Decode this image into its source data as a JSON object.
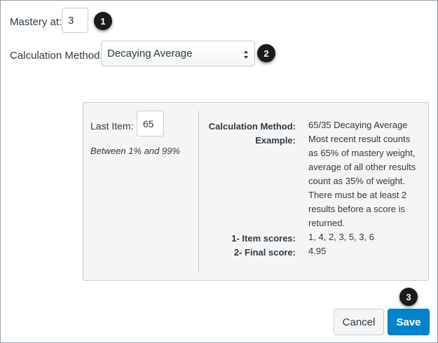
{
  "form": {
    "mastery_label": "Mastery at:",
    "mastery_value": "3",
    "calc_label": "Calculation Method:",
    "calc_selected": "Decaying Average"
  },
  "badges": [
    "1",
    "2",
    "3"
  ],
  "panel": {
    "last_item_label": "Last Item:",
    "last_item_value": "65",
    "range_hint": "Between 1% and 99%",
    "calc_method_key": "Calculation Method:",
    "calc_method_value": "65/35 Decaying Average",
    "example_key": "Example:",
    "example_lines": [
      "Most recent result counts",
      "as 65% of mastery weight,",
      "average of all other results",
      "count as 35% of weight.",
      "There must be at least 2",
      "results before a score is",
      "returned."
    ],
    "item_scores_key": "1- Item scores:",
    "item_scores_value": "1, 4, 2, 3, 5, 3, 6",
    "final_score_key": "2- Final score:",
    "final_score_value": "4.95"
  },
  "buttons": {
    "cancel": "Cancel",
    "save": "Save"
  },
  "colors": {
    "primary": "#0084cc",
    "badge": "#1b1b1b",
    "panel_bg": "#f5f5f5"
  }
}
